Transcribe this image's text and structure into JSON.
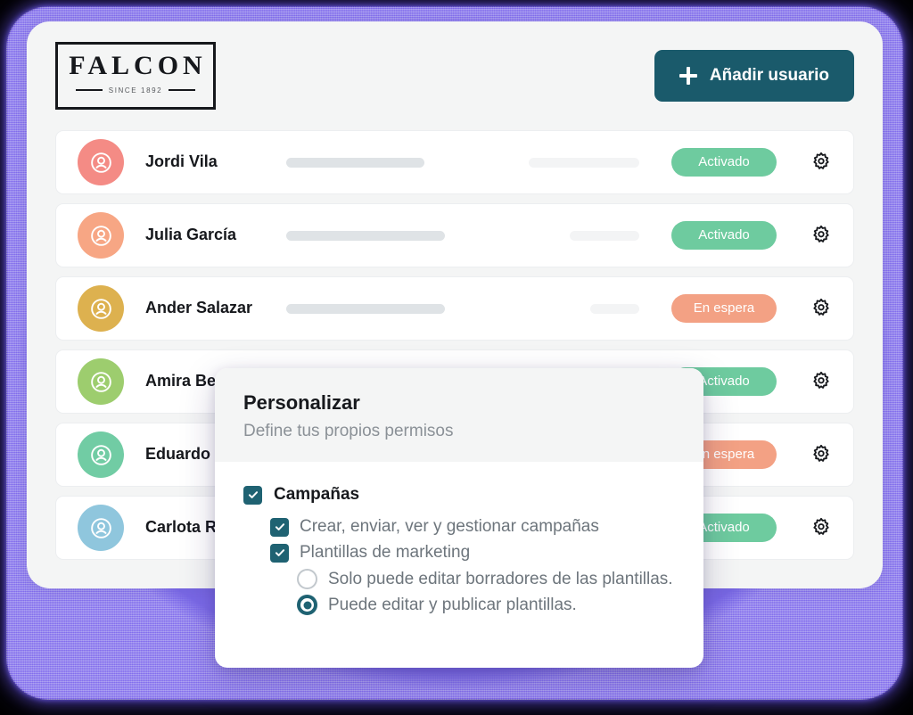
{
  "brand": {
    "name": "FALCON",
    "tagline": "SINCE 1892"
  },
  "header": {
    "add_user_label": "Añadir usuario",
    "add_user_icon": "plus-icon",
    "button_color": "#1a5a6b"
  },
  "colors": {
    "glow": "#7b6ae8",
    "card_bg": "#f4f5f5",
    "row_bg": "#ffffff",
    "accent_teal": "#1f6272",
    "status_active": "#6ecb9f",
    "status_waiting": "#f3a184"
  },
  "users": [
    {
      "name": "Jordi Vila",
      "avatar_color": "#f48b85",
      "avatar_icon": "user-circle-icon",
      "bar_a_width": 155,
      "bar_b_width": 124,
      "status": "Activado",
      "status_type": "activado",
      "gear_icon": "gear-icon"
    },
    {
      "name": "Julia García",
      "avatar_color": "#f7a684",
      "avatar_icon": "user-circle-icon",
      "bar_a_width": 178,
      "bar_b_width": 78,
      "status": "Activado",
      "status_type": "activado",
      "gear_icon": "gear-icon"
    },
    {
      "name": "Ander Salazar",
      "avatar_color": "#ddb martin",
      "avatar_color_hex": "#ddb košice",
      "bar_a_width": 178,
      "bar_b_width": 55,
      "status": "En espera",
      "status_type": "espera",
      "gear_icon": "gear-icon"
    },
    {
      "name": "Amira Benavides",
      "avatar_color": "#9dcd6e",
      "avatar_icon": "user-circle-icon",
      "bar_a_width": 150,
      "bar_b_width": 95,
      "status": "Activado",
      "status_type": "activado",
      "gear_icon": "gear-icon"
    },
    {
      "name": "Eduardo Serrano",
      "avatar_color": "#71ccA4",
      "avatar_icon": "user-circle-icon",
      "bar_a_width": 150,
      "bar_b_width": 95,
      "status": "En espera",
      "status_type": "espera",
      "gear_icon": "gear-icon"
    },
    {
      "name": "Carlota Ruiz",
      "avatar_color": "#8fc6dd",
      "avatar_icon": "user-circle-icon",
      "bar_a_width": 150,
      "bar_b_width": 95,
      "status": "Activado",
      "status_type": "activado",
      "gear_icon": "gear-icon"
    }
  ],
  "avatar_colors": [
    "#f48b85",
    "#f7a684",
    "#ddb14f",
    "#9dcd6e",
    "#71cca4",
    "#8fc6dd"
  ],
  "modal": {
    "title": "Personalizar",
    "subtitle": "Define tus propios permisos",
    "groups": [
      {
        "label": "Campañas",
        "checked": true,
        "control": "checkbox",
        "items": [
          {
            "label": "Crear, enviar, ver y gestionar campañas",
            "checked": true,
            "control": "checkbox"
          },
          {
            "label": "Plantillas de marketing",
            "checked": true,
            "control": "checkbox"
          },
          {
            "label": "Solo puede editar borradores de las plantillas.",
            "selected": false,
            "control": "radio"
          },
          {
            "label": "Puede editar y publicar plantillas.",
            "selected": true,
            "control": "radio"
          }
        ]
      }
    ]
  }
}
